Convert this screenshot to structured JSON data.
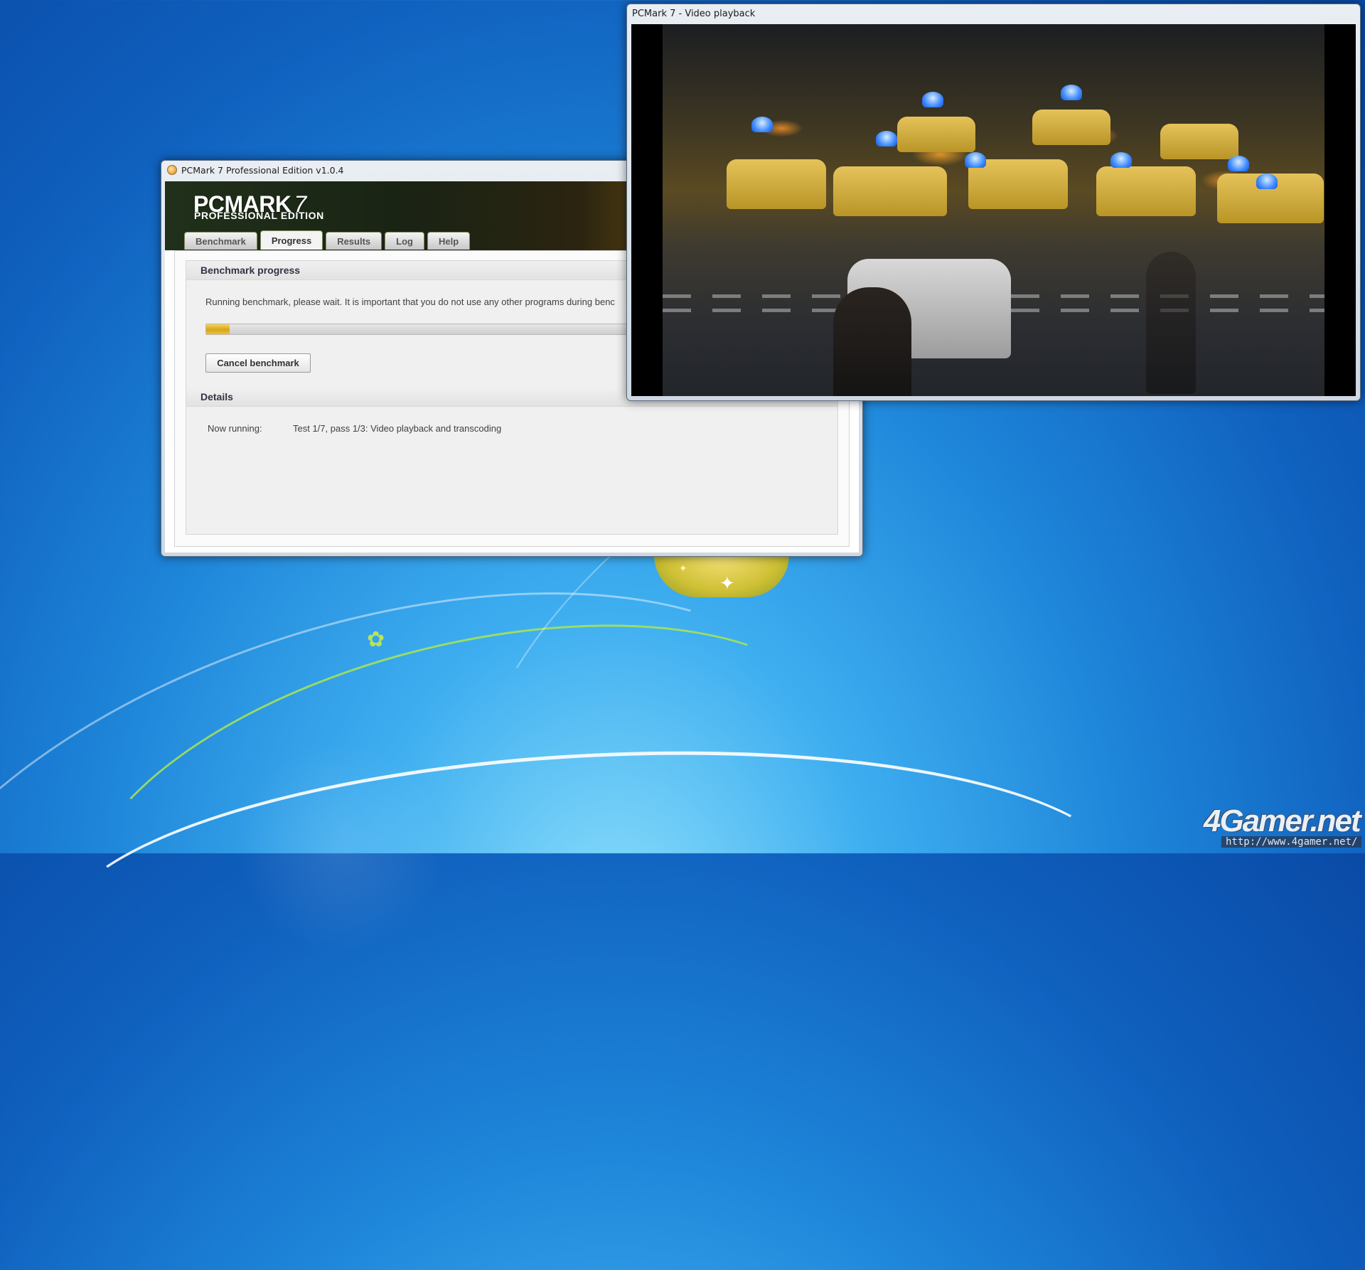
{
  "pcmark_window": {
    "title": "PCMark 7 Professional Edition v1.0.4",
    "logo_main": "PCMARK",
    "logo_number": "7",
    "logo_sub": "PROFESSIONAL EDITION",
    "tabs": [
      {
        "label": "Benchmark",
        "active": false
      },
      {
        "label": "Progress",
        "active": true
      },
      {
        "label": "Results",
        "active": false
      },
      {
        "label": "Log",
        "active": false
      },
      {
        "label": "Help",
        "active": false
      }
    ],
    "progress_section": {
      "title": "Benchmark progress",
      "message": "Running benchmark, please wait. It is important that you do not use any other programs during benc",
      "progress_fraction": 0.045,
      "cancel_button": "Cancel benchmark"
    },
    "details_section": {
      "title": "Details",
      "now_running_label": "Now running:",
      "now_running_value": "Test 1/7, pass 1/3: Video playback and transcoding"
    }
  },
  "video_window": {
    "title": "PCMark 7 - Video playback"
  },
  "watermark": {
    "logo": "4Gamer.net",
    "url": "http://www.4gamer.net/"
  },
  "colors": {
    "desktop_blue": "#1d84d8",
    "progress_fill": "#d8a518",
    "video_background": "#000000"
  },
  "icons": [
    "pcmark-app-icon",
    "flower-icon"
  ]
}
